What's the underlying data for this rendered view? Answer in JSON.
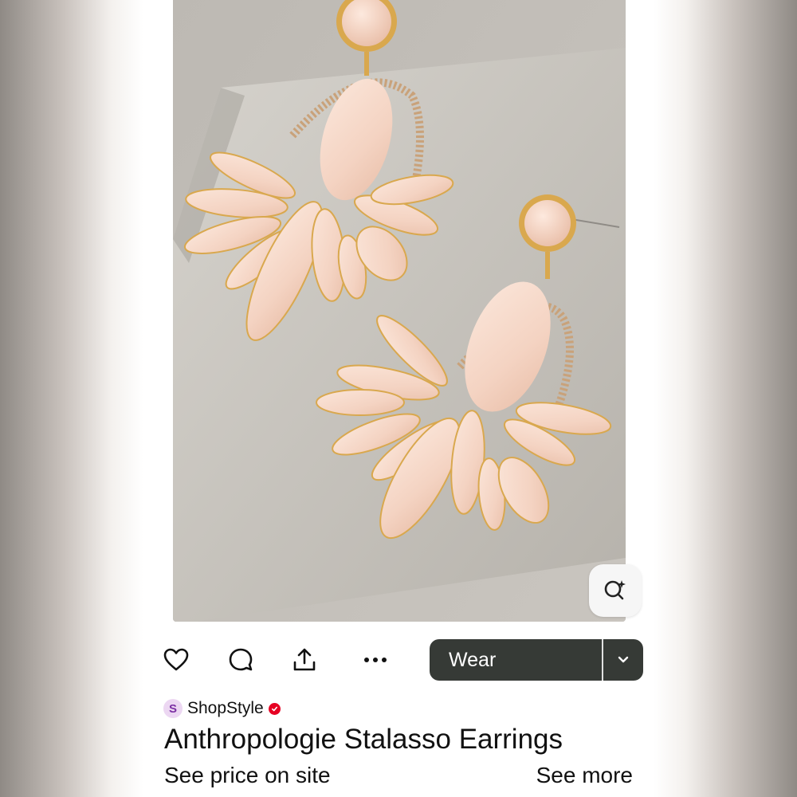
{
  "pin": {
    "image_alt": "Peach flower statement earrings"
  },
  "actions": {
    "like_icon": "heart-icon",
    "comment_icon": "comment-icon",
    "share_icon": "share-icon",
    "more_icon": "more-dots-icon",
    "wear_label": "Wear",
    "dropdown_icon": "chevron-down-icon"
  },
  "source": {
    "logo_letter": "S",
    "name": "ShopStyle",
    "verified_icon": "verified-check-icon"
  },
  "product": {
    "title": "Anthropologie Stalasso Earrings",
    "price_text": "See price on site",
    "see_more": "See more"
  },
  "lens": {
    "icon": "visual-search-icon"
  },
  "colors": {
    "wear_button": "#363a36",
    "verified_badge": "#e60023",
    "brand_logo_bg": "#ecd7f2",
    "brand_logo_fg": "#7b2fa3"
  }
}
